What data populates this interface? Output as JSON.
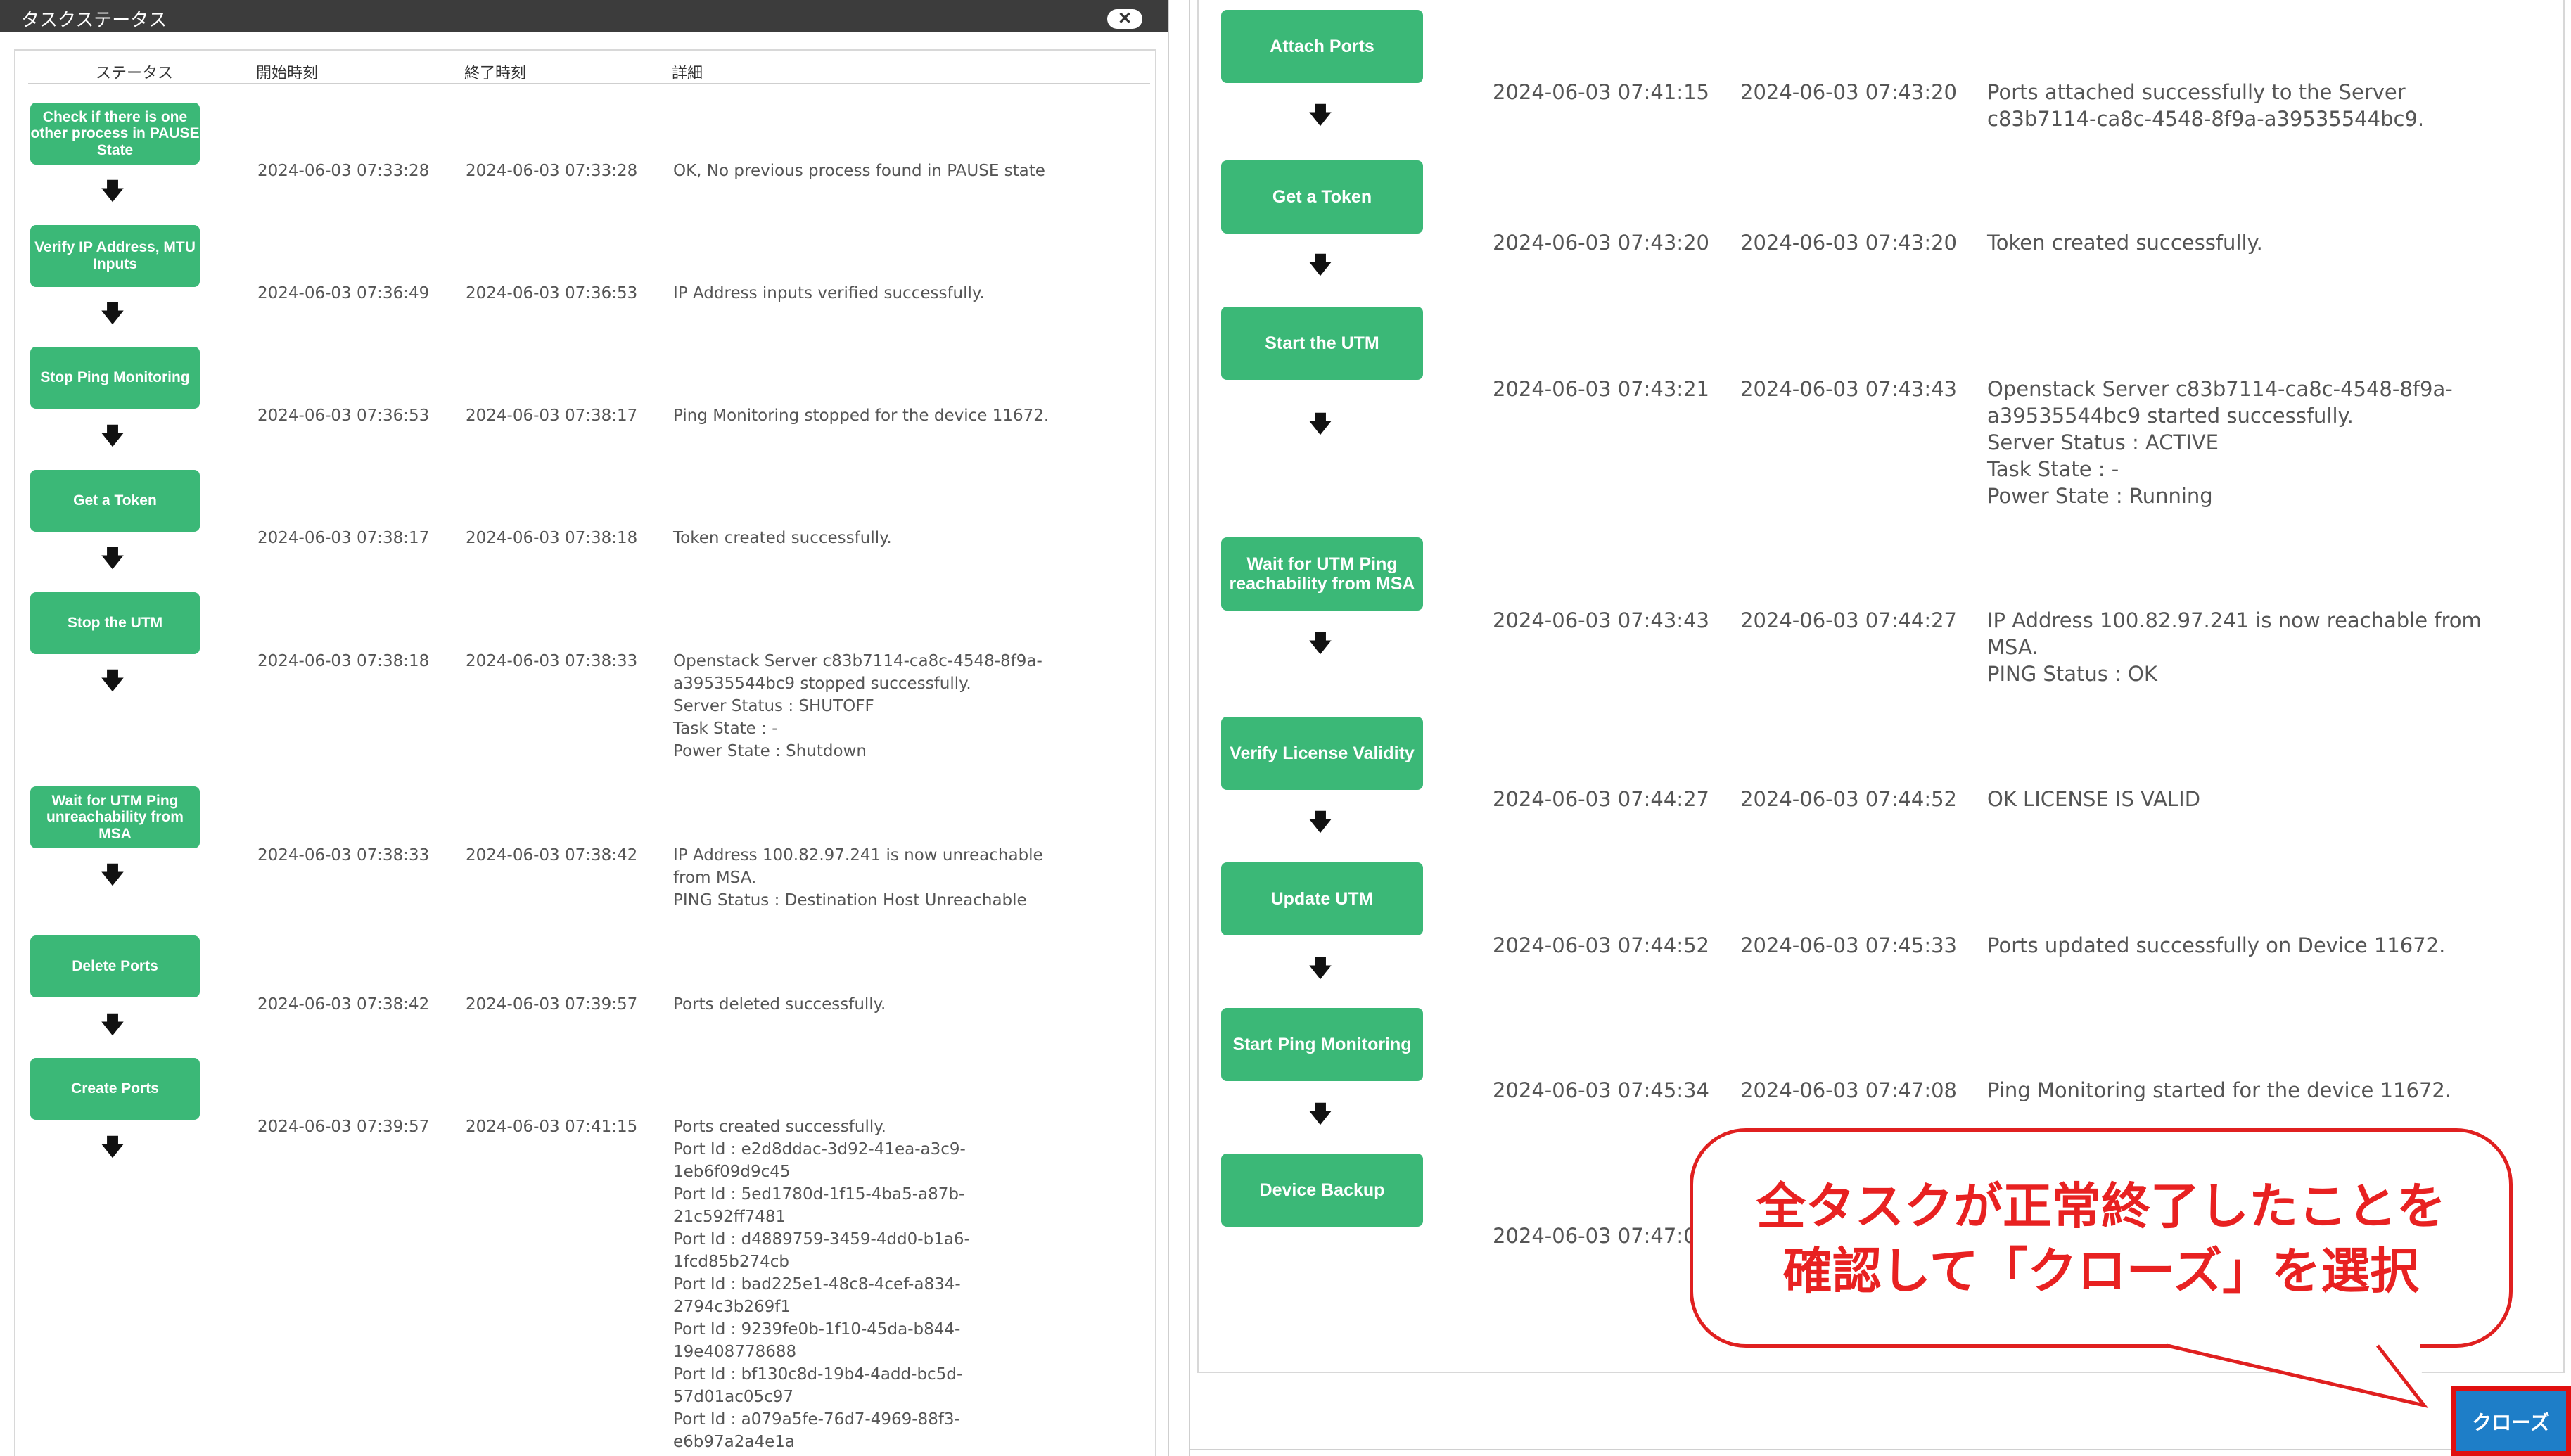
{
  "dialog": {
    "title": "タスクステータス",
    "close_icon": "✕"
  },
  "columns": {
    "status": "ステータス",
    "start": "開始時刻",
    "end": "終了時刻",
    "detail": "詳細"
  },
  "left_rows": [
    {
      "step": "Check if there is one other process in PAUSE State",
      "start": "2024-06-03 07:33:28",
      "end": "2024-06-03 07:33:28",
      "detail": "OK, No previous process found in PAUSE state"
    },
    {
      "step": "Verify IP Address, MTU Inputs",
      "start": "2024-06-03 07:36:49",
      "end": "2024-06-03 07:36:53",
      "detail": "IP Address inputs verified successfully."
    },
    {
      "step": "Stop Ping Monitoring",
      "start": "2024-06-03 07:36:53",
      "end": "2024-06-03 07:38:17",
      "detail": "Ping Monitoring stopped for the device 11672."
    },
    {
      "step": "Get a Token",
      "start": "2024-06-03 07:38:17",
      "end": "2024-06-03 07:38:18",
      "detail": "Token created successfully."
    },
    {
      "step": "Stop the UTM",
      "start": "2024-06-03 07:38:18",
      "end": "2024-06-03 07:38:33",
      "detail": "Openstack Server c83b7114-ca8c-4548-8f9a-\na39535544bc9 stopped successfully.\nServer Status : SHUTOFF\nTask State : -\nPower State : Shutdown"
    },
    {
      "step": "Wait for UTM Ping unreachability from MSA",
      "start": "2024-06-03 07:38:33",
      "end": "2024-06-03 07:38:42",
      "detail": "IP Address 100.82.97.241 is now unreachable\nfrom MSA.\nPING Status : Destination Host Unreachable"
    },
    {
      "step": "Delete Ports",
      "start": "2024-06-03 07:38:42",
      "end": "2024-06-03 07:39:57",
      "detail": "Ports deleted successfully."
    },
    {
      "step": "Create Ports",
      "start": "2024-06-03 07:39:57",
      "end": "2024-06-03 07:41:15",
      "detail": "Ports created successfully.\nPort Id : e2d8ddac-3d92-41ea-a3c9-\n1eb6f09d9c45\nPort Id : 5ed1780d-1f15-4ba5-a87b-\n21c592ff7481\nPort Id : d4889759-3459-4dd0-b1a6-\n1fcd85b274cb\nPort Id : bad225e1-48c8-4cef-a834-\n2794c3b269f1\nPort Id : 9239fe0b-1f10-45da-b844-\n19e408778688\nPort Id : bf130c8d-19b4-4add-bc5d-\n57d01ac05c97\nPort Id : a079a5fe-76d7-4969-88f3-\ne6b97a2a4e1a"
    }
  ],
  "right_rows": [
    {
      "step": "Attach Ports",
      "start": "2024-06-03 07:41:15",
      "end": "2024-06-03 07:43:20",
      "detail": "Ports attached successfully to the Server\nc83b7114-ca8c-4548-8f9a-a39535544bc9."
    },
    {
      "step": "Get a Token",
      "start": "2024-06-03 07:43:20",
      "end": "2024-06-03 07:43:20",
      "detail": "Token created successfully."
    },
    {
      "step": "Start the UTM",
      "start": "2024-06-03 07:43:21",
      "end": "2024-06-03 07:43:43",
      "detail": "Openstack Server c83b7114-ca8c-4548-8f9a-\na39535544bc9 started successfully.\nServer Status : ACTIVE\nTask State : -\nPower State : Running"
    },
    {
      "step": "Wait for UTM Ping reachability from MSA",
      "start": "2024-06-03 07:43:43",
      "end": "2024-06-03 07:44:27",
      "detail": "IP Address 100.82.97.241 is now reachable from\nMSA.\nPING Status : OK"
    },
    {
      "step": "Verify License Validity",
      "start": "2024-06-03 07:44:27",
      "end": "2024-06-03 07:44:52",
      "detail": "OK LICENSE IS VALID"
    },
    {
      "step": "Update UTM",
      "start": "2024-06-03 07:44:52",
      "end": "2024-06-03 07:45:33",
      "detail": "Ports updated successfully on Device 11672."
    },
    {
      "step": "Start Ping Monitoring",
      "start": "2024-06-03 07:45:34",
      "end": "2024-06-03 07:47:08",
      "detail": "Ping Monitoring started for the device 11672."
    },
    {
      "step": "Device Backup",
      "start": "2024-06-03 07:47:0",
      "end": "",
      "detail": ""
    }
  ],
  "arrow_glyph": "🡇",
  "callout": {
    "text": "全タスクが正常終了したことを\n確認して「クローズ」を選択"
  },
  "close_button": {
    "label": "クローズ"
  },
  "colors": {
    "step_green": "#3bb877",
    "callout_red": "#e02020",
    "button_blue": "#1e7ec8"
  }
}
